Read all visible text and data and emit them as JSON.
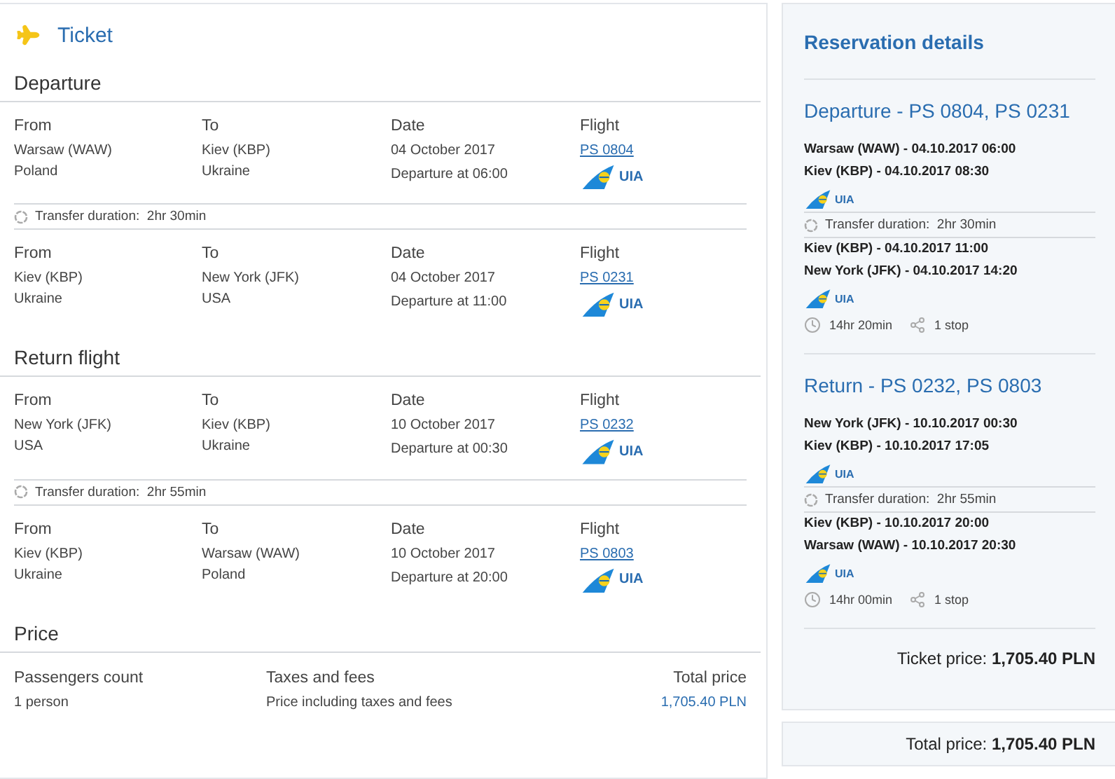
{
  "ticket": {
    "title": "Ticket",
    "legs": [
      {
        "title": "Departure",
        "items": [
          {
            "kind": "segment",
            "labels": [
              "From",
              "To",
              "Date",
              "Flight"
            ],
            "from_city": "Warsaw (WAW)",
            "from_country": "Poland",
            "to_city": "Kiev (KBP)",
            "to_country": "Ukraine",
            "date": "04 October 2017",
            "departure": "Departure at 06:00",
            "flight": "PS 0804",
            "airline": "UIA"
          },
          {
            "kind": "transfer",
            "text": "Transfer duration:  2hr 30min"
          },
          {
            "kind": "segment",
            "labels": [
              "From",
              "To",
              "Date",
              "Flight"
            ],
            "from_city": "Kiev (KBP)",
            "from_country": "Ukraine",
            "to_city": "New York (JFK)",
            "to_country": "USA",
            "date": "04 October 2017",
            "departure": "Departure at 11:00",
            "flight": "PS 0231",
            "airline": "UIA"
          }
        ]
      },
      {
        "title": "Return flight",
        "items": [
          {
            "kind": "segment",
            "labels": [
              "From",
              "To",
              "Date",
              "Flight"
            ],
            "from_city": "New York (JFK)",
            "from_country": "USA",
            "to_city": "Kiev (KBP)",
            "to_country": "Ukraine",
            "date": "10 October 2017",
            "departure": "Departure at 00:30",
            "flight": "PS 0232",
            "airline": "UIA"
          },
          {
            "kind": "transfer",
            "text": "Transfer duration:  2hr 55min"
          },
          {
            "kind": "segment",
            "labels": [
              "From",
              "To",
              "Date",
              "Flight"
            ],
            "from_city": "Kiev (KBP)",
            "from_country": "Ukraine",
            "to_city": "Warsaw (WAW)",
            "to_country": "Poland",
            "date": "10 October 2017",
            "departure": "Departure at 20:00",
            "flight": "PS 0803",
            "airline": "UIA"
          }
        ]
      }
    ],
    "price": {
      "title": "Price",
      "columns": [
        {
          "label": "Passengers count",
          "value": "1 person"
        },
        {
          "label": "Taxes and fees",
          "value": "Price including taxes and fees"
        },
        {
          "label": "Total price",
          "value": "1,705.40 PLN"
        }
      ]
    }
  },
  "reservation": {
    "title": "Reservation details",
    "trips": [
      {
        "title": "Departure - PS 0804, PS 0231",
        "items": [
          {
            "kind": "segment",
            "lines": [
              "Warsaw (WAW) - 04.10.2017 06:00",
              "Kiev (KBP) - 04.10.2017 08:30"
            ],
            "airline": "UIA"
          },
          {
            "kind": "transfer",
            "text": "Transfer duration:  2hr 30min"
          },
          {
            "kind": "segment",
            "lines": [
              "Kiev (KBP) - 04.10.2017 11:00",
              "New York (JFK) - 04.10.2017 14:20"
            ],
            "airline": "UIA"
          }
        ],
        "duration": "14hr 20min",
        "stops": "1 stop"
      },
      {
        "title": "Return - PS 0232, PS 0803",
        "items": [
          {
            "kind": "segment",
            "lines": [
              "New York (JFK) - 10.10.2017 00:30",
              "Kiev (KBP) - 10.10.2017 17:05"
            ],
            "airline": "UIA"
          },
          {
            "kind": "transfer",
            "text": "Transfer duration:  2hr 55min"
          },
          {
            "kind": "segment",
            "lines": [
              "Kiev (KBP) - 10.10.2017 20:00",
              "Warsaw (WAW) - 10.10.2017 20:30"
            ],
            "airline": "UIA"
          }
        ],
        "duration": "14hr 00min",
        "stops": "1 stop"
      }
    ],
    "ticket_price": {
      "label": "Ticket price:",
      "value": "1,705.40 PLN"
    },
    "total_price": {
      "label": "Total price:",
      "value": "1,705.40 PLN"
    }
  }
}
